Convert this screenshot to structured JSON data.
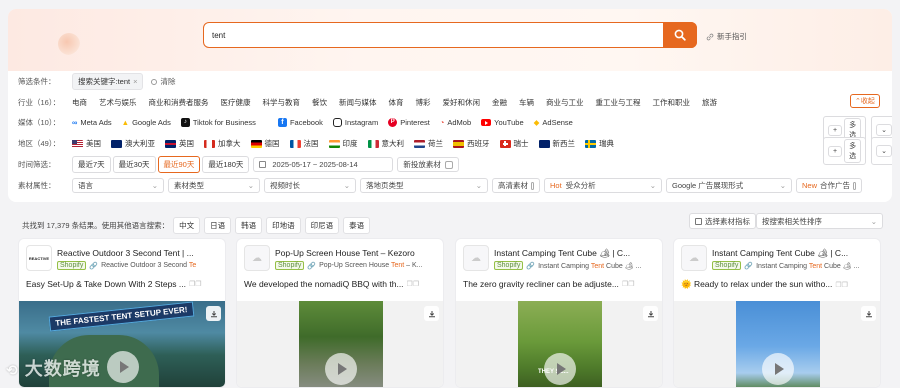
{
  "search": {
    "value": "tent",
    "guide": "新手指引"
  },
  "filters": {
    "label": "筛选条件：",
    "tag": "搜索关键字:tent",
    "clear": "清除"
  },
  "industry": {
    "label": "行业（16）：",
    "items": [
      "电商",
      "艺术与娱乐",
      "商业和消费者服务",
      "医疗健康",
      "科学与教育",
      "餐饮",
      "新闻与媒体",
      "体育",
      "博彩",
      "爱好和休闲",
      "金融",
      "车辆",
      "商业与工业",
      "重工业与工程",
      "工作和职业",
      "旅游"
    ],
    "collapse": "收起"
  },
  "media": {
    "label": "媒体（10）：",
    "items": [
      "Meta Ads",
      "Google Ads",
      "Tiktok for Business",
      "Facebook",
      "Instagram",
      "Pinterest",
      "AdMob",
      "YouTube",
      "AdSense"
    ],
    "multi": "多选",
    "more": "更多"
  },
  "region": {
    "label": "地区（49）：",
    "items": [
      {
        "name": "美国",
        "flag": "us"
      },
      {
        "name": "澳大利亚",
        "flag": "au"
      },
      {
        "name": "英国",
        "flag": "gb"
      },
      {
        "name": "加拿大",
        "flag": "ca"
      },
      {
        "name": "德国",
        "flag": "de"
      },
      {
        "name": "法国",
        "flag": "fr"
      },
      {
        "name": "印度",
        "flag": "in"
      },
      {
        "name": "意大利",
        "flag": "it"
      },
      {
        "name": "荷兰",
        "flag": "nl"
      },
      {
        "name": "西班牙",
        "flag": "es"
      },
      {
        "name": "瑞士",
        "flag": "ch"
      },
      {
        "name": "新西兰",
        "flag": "nz"
      },
      {
        "name": "瑞典",
        "flag": "se"
      }
    ],
    "multi": "多选",
    "more": "更多"
  },
  "time": {
    "label": "时间筛选：",
    "options": [
      "最近7天",
      "最近30天",
      "最近90天",
      "最近180天"
    ],
    "active": 2,
    "range": "2025-05-17 ~ 2025-08-14",
    "new_label": "新投放素材"
  },
  "attrs": {
    "label": "素材属性：",
    "selects": [
      "语言",
      "素材类型",
      "视频时长",
      "落地页类型"
    ],
    "hq": "高清素材",
    "hot_badge": "Hot",
    "hot_label": "受众分析",
    "format": "Google 广告展现形式",
    "new_badge": "New",
    "new_label": "合作广告"
  },
  "results": {
    "text": "共找到 17,379 条结果。使用其他语言搜索：",
    "langs": [
      "中文",
      "日语",
      "韩语",
      "印地语",
      "印尼语",
      "泰语"
    ],
    "metric": "选择素材指标",
    "sort": "按搜索相关性排序"
  },
  "cards": [
    {
      "title": "Reactive Outdoor 3 Second Tent | ...",
      "shop": "Shopify",
      "link_pre": "Reactive Outdoor 3 Second ",
      "link_hl": "Te",
      "desc": "Easy Set-Up & Take Down With 2 Steps ...",
      "overlay": "THE FASTEST TENT SETUP EVER!",
      "logo_text": "REACTIVE"
    },
    {
      "title": "Pop-Up Screen House Tent – Kezoro",
      "shop": "Shopify",
      "link_pre": "Pop-Up Screen House ",
      "link_hl": "Tent",
      "link_post": " – K...",
      "desc": "We developed the nomadiQ BBQ with th..."
    },
    {
      "title": "Instant Camping Tent Cube 🏕 | C...",
      "shop": "Shopify",
      "link_pre": "Instant Camping ",
      "link_hl": "Tent",
      "link_post": " Cube 🏕 ...",
      "desc": "The zero gravity recliner can be adjuste...",
      "overlay": "THEY SE..."
    },
    {
      "title": "Instant Camping Tent Cube 🏕 | C...",
      "shop": "Shopify",
      "link_pre": "Instant Camping ",
      "link_hl": "Tent",
      "link_post": " Cube 🏕 ...",
      "desc": "🌞 Ready to relax under the sun witho..."
    }
  ],
  "watermark": "大数跨境",
  "colors": {
    "accent": "#e6681f",
    "shopify": "#95bf47"
  }
}
